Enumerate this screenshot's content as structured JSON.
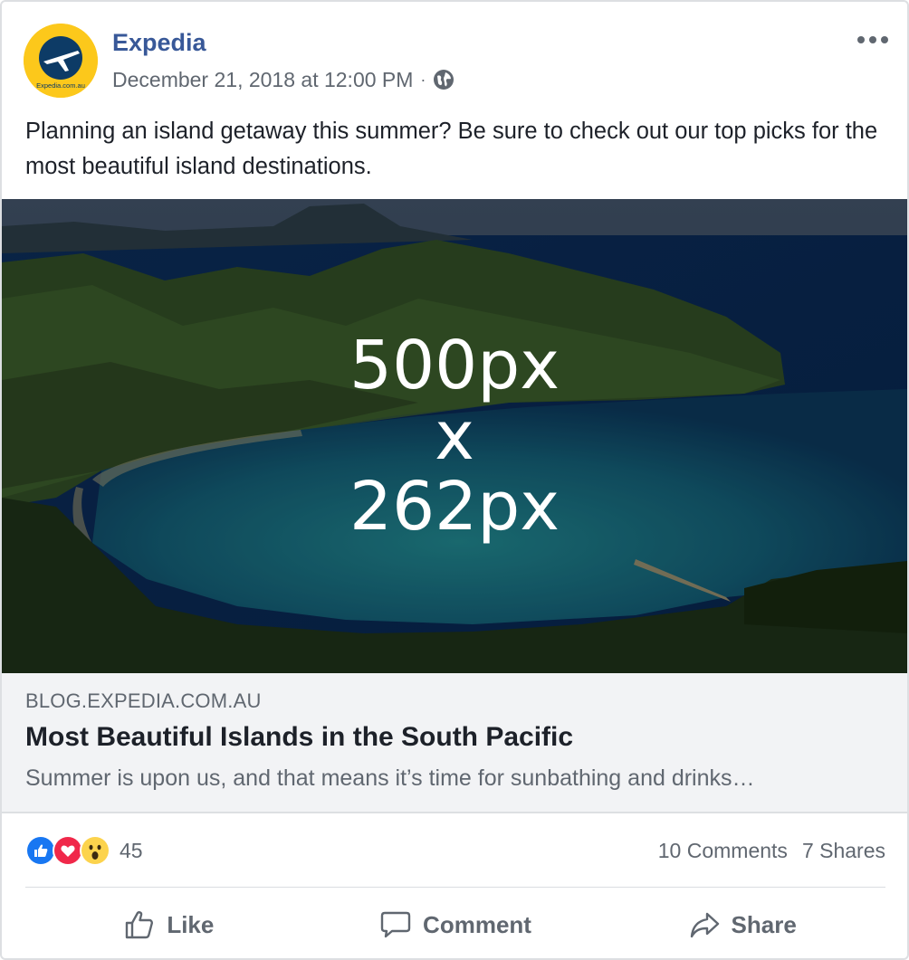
{
  "post": {
    "page_name": "Expedia",
    "avatar_text": "Expedia.com.au",
    "timestamp": "December 21, 2018 at 12:00 PM",
    "separator": "·",
    "privacy_icon": "globe-icon",
    "more_icon": "more-options-icon",
    "text": "Planning an island getaway this summer? Be sure to check out our top picks for the most beautiful island destinations."
  },
  "image": {
    "caption_line1": "500px",
    "caption_line2": "x",
    "caption_line3": "262px"
  },
  "link_preview": {
    "domain": "BLOG.EXPEDIA.COM.AU",
    "title": "Most Beautiful Islands in the South Pacific",
    "description": "Summer is upon us, and that means it’s time for sunbathing and drinks…"
  },
  "stats": {
    "reactions": [
      "like-reaction-icon",
      "love-reaction-icon",
      "wow-reaction-icon"
    ],
    "reaction_count": "45",
    "comments": "10 Comments",
    "shares": "7 Shares"
  },
  "actions": {
    "like": "Like",
    "comment": "Comment",
    "share": "Share"
  },
  "colors": {
    "page_name": "#385898",
    "meta_text": "#606770",
    "link_bg": "#f2f3f5",
    "like_blue": "#1877f2",
    "love_red": "#f0284a",
    "wow_yellow": "#fcd34d",
    "avatar_yellow": "#fcc81b"
  }
}
